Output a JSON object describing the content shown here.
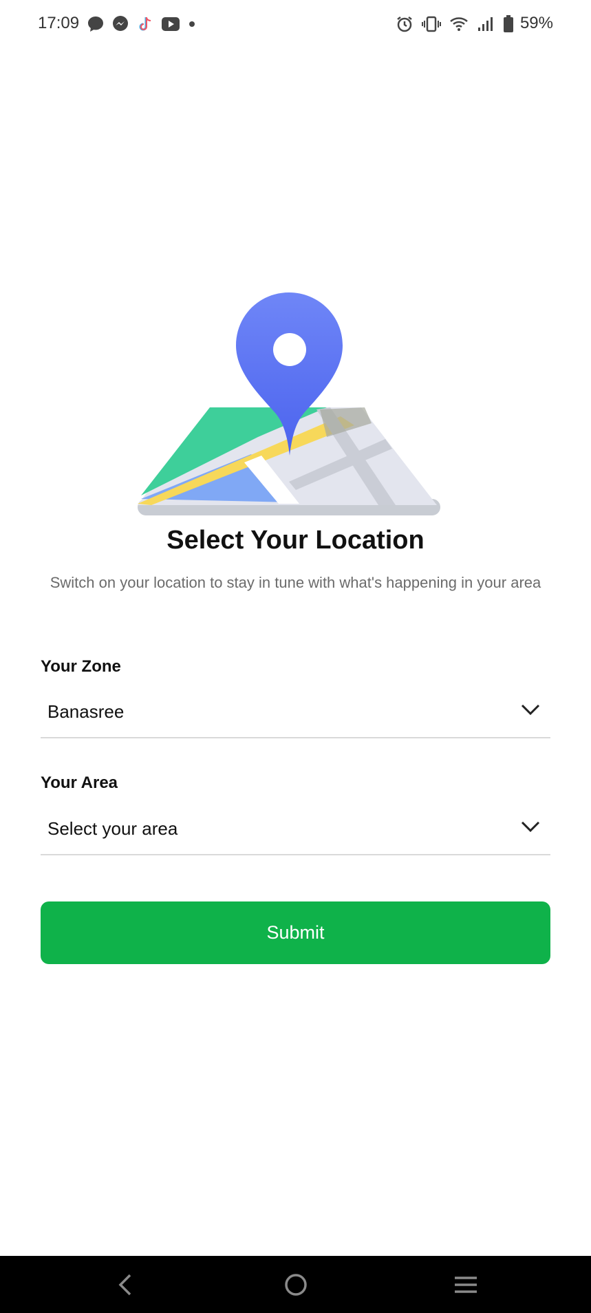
{
  "status_bar": {
    "time": "17:09",
    "battery": "59%",
    "notification_icons": [
      "message-icon",
      "messenger-icon",
      "tiktok-icon",
      "youtube-icon",
      "dot-icon"
    ],
    "system_icons": [
      "alarm-icon",
      "vibrate-icon",
      "wifi-icon",
      "signal-icon",
      "battery-icon"
    ]
  },
  "illustration": {
    "icon": "map-location-pin-icon",
    "pin_color": "#5b73f2"
  },
  "main": {
    "title": "Select Your Location",
    "subtitle": "Switch on your location to stay in tune with what's happening in your area"
  },
  "form": {
    "zone": {
      "label": "Your Zone",
      "value": "Banasree"
    },
    "area": {
      "label": "Your Area",
      "value": "Select your area"
    },
    "submit_label": "Submit"
  },
  "colors": {
    "accent": "#0fb24a",
    "background": "#ffffff",
    "nav_bar": "#000000"
  },
  "nav_bar": {
    "buttons": [
      "back-icon",
      "home-icon",
      "menu-icon"
    ]
  }
}
